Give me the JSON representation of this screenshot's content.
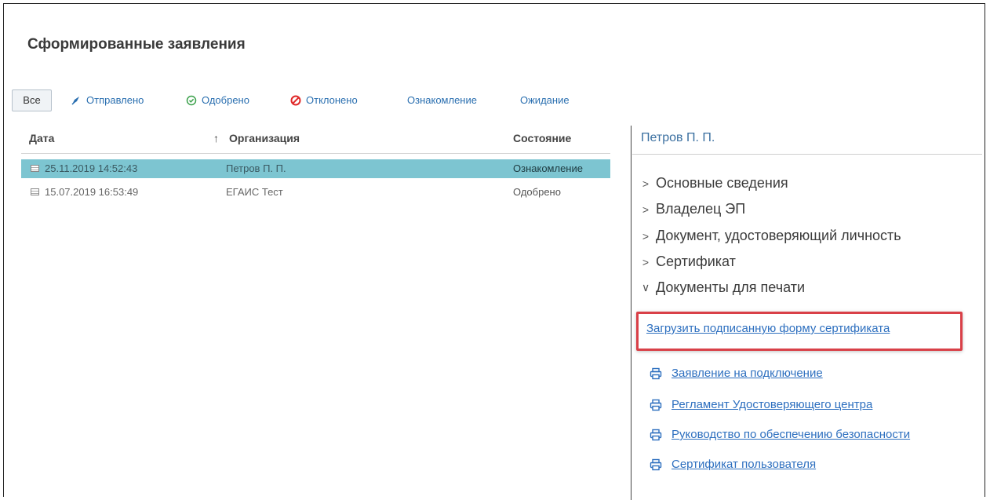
{
  "page": {
    "title": "Сформированные заявления"
  },
  "filters": [
    {
      "label": "Все",
      "icon": ""
    },
    {
      "label": "Отправлено",
      "icon": "send-icon"
    },
    {
      "label": "Одобрено",
      "icon": "check-circle-icon"
    },
    {
      "label": "Отклонено",
      "icon": "cancel-circle-icon"
    },
    {
      "label": "Ознакомление",
      "icon": ""
    },
    {
      "label": "Ожидание",
      "icon": ""
    }
  ],
  "table": {
    "columns": {
      "date": "Дата",
      "sort_arrow": "↑",
      "organization": "Организация",
      "state": "Состояние"
    },
    "rows": [
      {
        "date": "25.11.2019 14:52:43",
        "organization": "Петров П. П.",
        "state": "Ознакомление",
        "selected": true
      },
      {
        "date": "15.07.2019 16:53:49",
        "organization": "ЕГАИС Тест",
        "state": "Одобрено",
        "selected": false
      }
    ]
  },
  "details": {
    "title": "Петров П. П.",
    "sections": [
      {
        "label": "Основные сведения",
        "chevron": ">"
      },
      {
        "label": "Владелец ЭП",
        "chevron": ">"
      },
      {
        "label": "Документ, удостоверяющий личность",
        "chevron": ">"
      },
      {
        "label": "Сертификат",
        "chevron": ">"
      },
      {
        "label": "Документы для печати",
        "chevron": "∨"
      }
    ],
    "upload_link": "Загрузить подписанную форму сертификата",
    "print_docs": [
      {
        "label": "Заявление на подключение",
        "icon": "printer-icon"
      },
      {
        "label": "Регламент Удостоверяющего центра",
        "icon": "printer-icon"
      },
      {
        "label": "Руководство по обеспечению безопасности",
        "icon": "printer-icon"
      },
      {
        "label": "Сертификат пользователя",
        "icon": "printer-icon"
      }
    ]
  },
  "colors": {
    "selected_row": "#7dc5d1",
    "link": "#2d6fbf",
    "highlight_border": "#d94048",
    "approved_icon": "#3aa04a",
    "rejected_icon": "#e02828"
  }
}
